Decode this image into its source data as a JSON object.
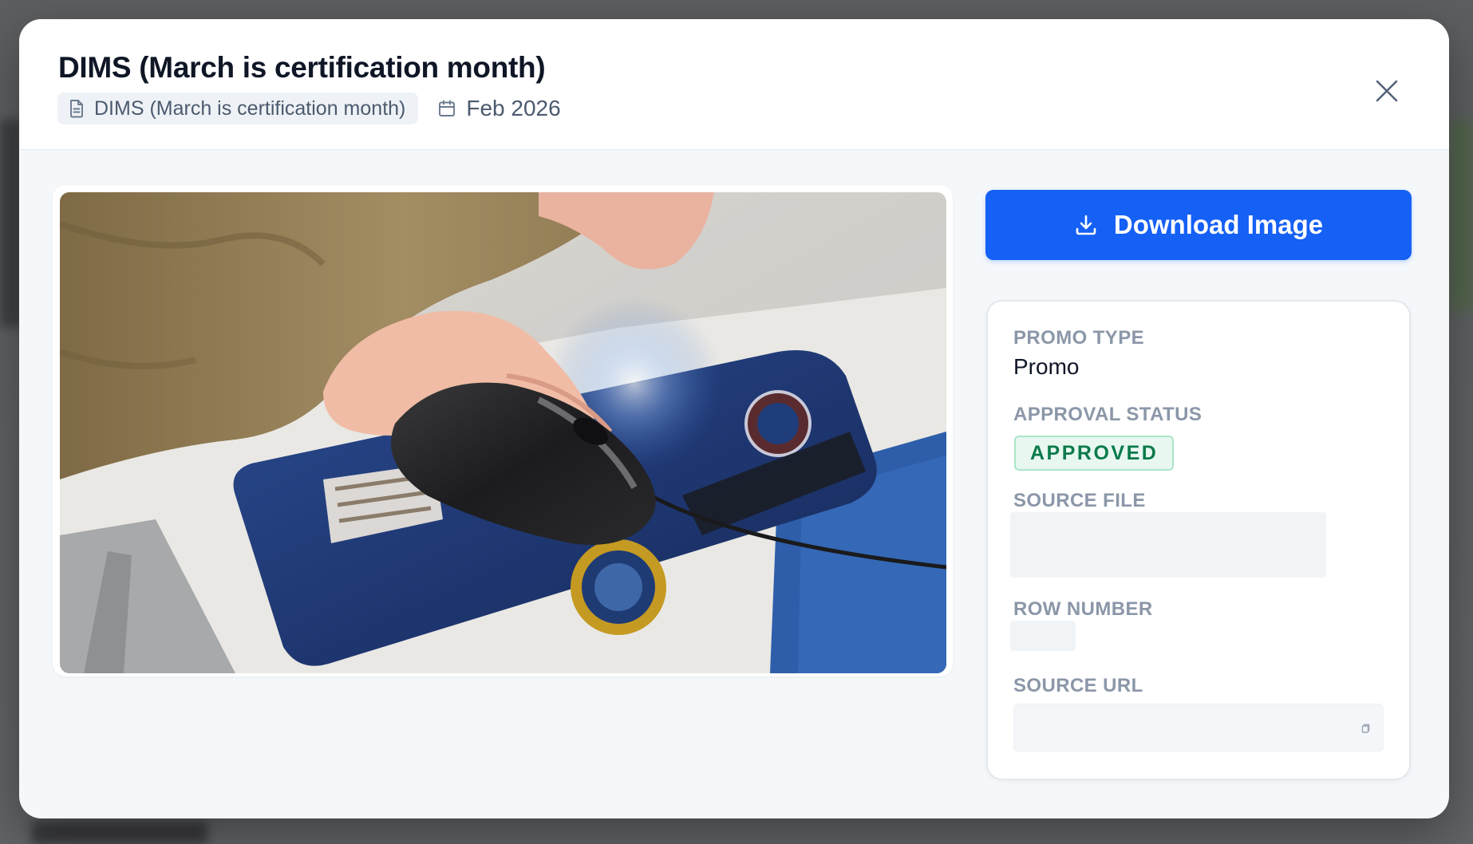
{
  "modal": {
    "title": "DIMS (March is certification month)",
    "source_chip_label": "DIMS (March is certification month)",
    "date": "Feb 2026"
  },
  "icons": {
    "file": "file-text-icon",
    "calendar": "calendar-icon",
    "close": "close-icon",
    "download": "download-icon",
    "copy": "copy-icon"
  },
  "actions": {
    "download_label": "Download Image"
  },
  "details": {
    "promo_type_label": "PROMO TYPE",
    "promo_type_value": "Promo",
    "approval_status_label": "APPROVAL STATUS",
    "approval_status_value": "APPROVED",
    "source_file_label": "SOURCE FILE",
    "row_number_label": "ROW NUMBER",
    "source_url_label": "SOURCE URL"
  },
  "colors": {
    "primary": "#1560f5",
    "approved_text": "#0b7a4b",
    "approved_bg": "#e8f8f0",
    "label_gray": "#8b97a8"
  }
}
